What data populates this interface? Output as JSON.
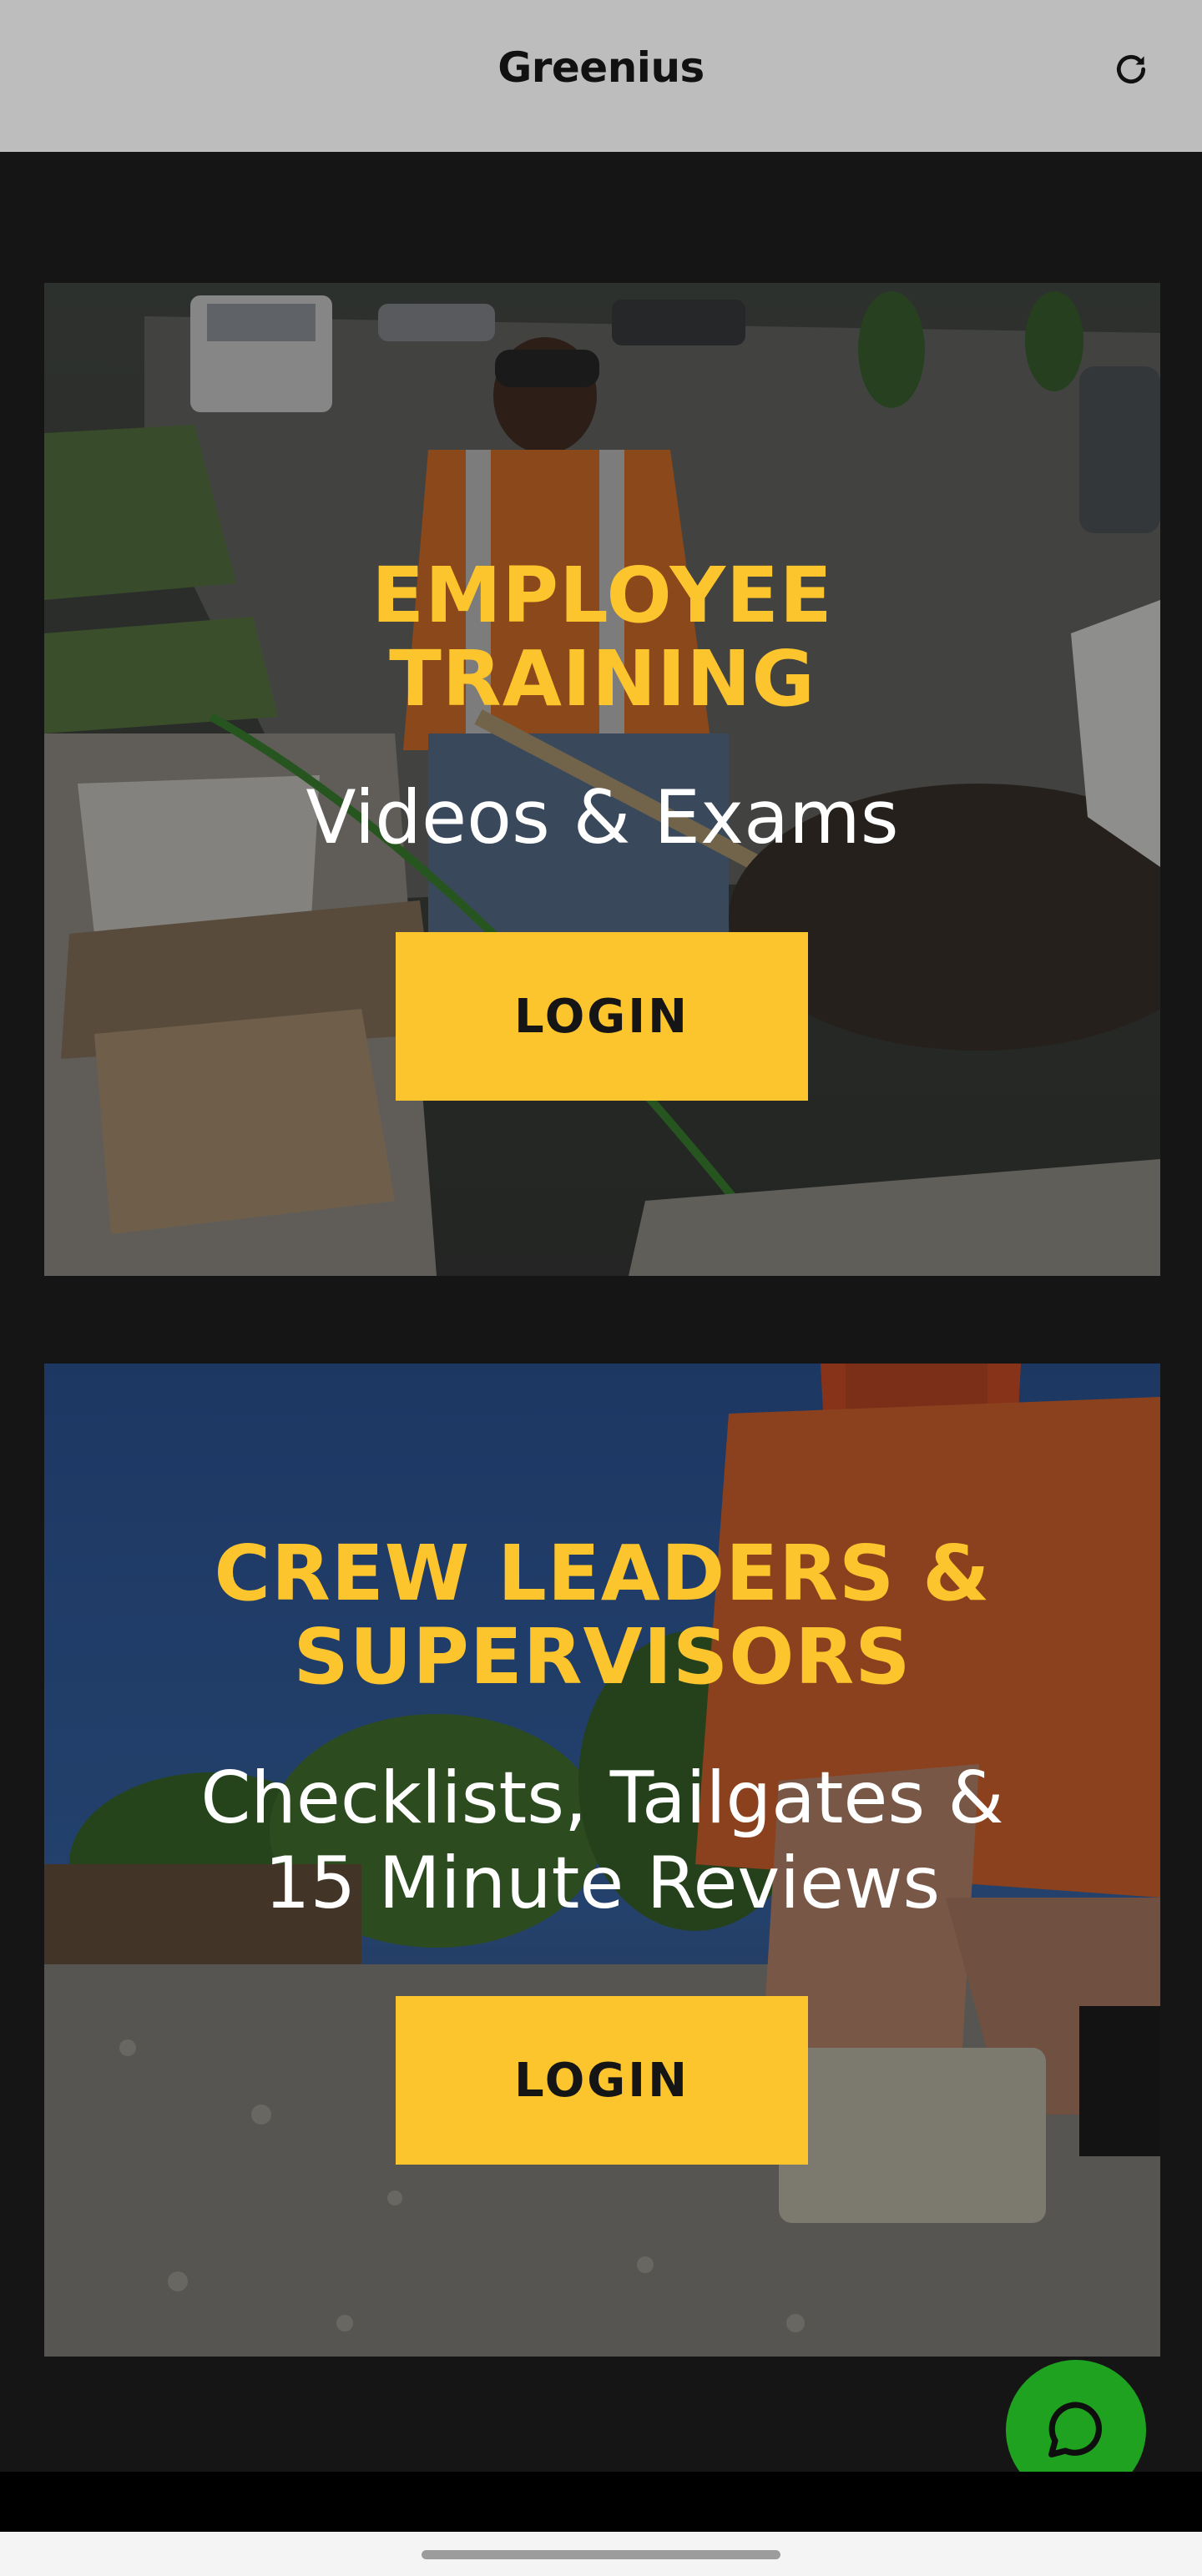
{
  "app_bar": {
    "title": "Greenius",
    "refresh_icon": "refresh-icon"
  },
  "cards": [
    {
      "title_lines": [
        "EMPLOYEE",
        "TRAINING"
      ],
      "subtitle_lines": [
        "Videos & Exams"
      ],
      "button_label": "LOGIN"
    },
    {
      "title_lines": [
        "CREW LEADERS &",
        "SUPERVISORS"
      ],
      "subtitle_lines": [
        "Checklists, Tailgates &",
        "15 Minute Reviews"
      ],
      "button_label": "LOGIN"
    }
  ],
  "chat_button": {
    "icon": "chat-bubble-icon",
    "color": "#1fa21f"
  },
  "colors": {
    "accent": "#fcc42d",
    "background": "#151515",
    "app_bar": "#bdbdbd"
  }
}
